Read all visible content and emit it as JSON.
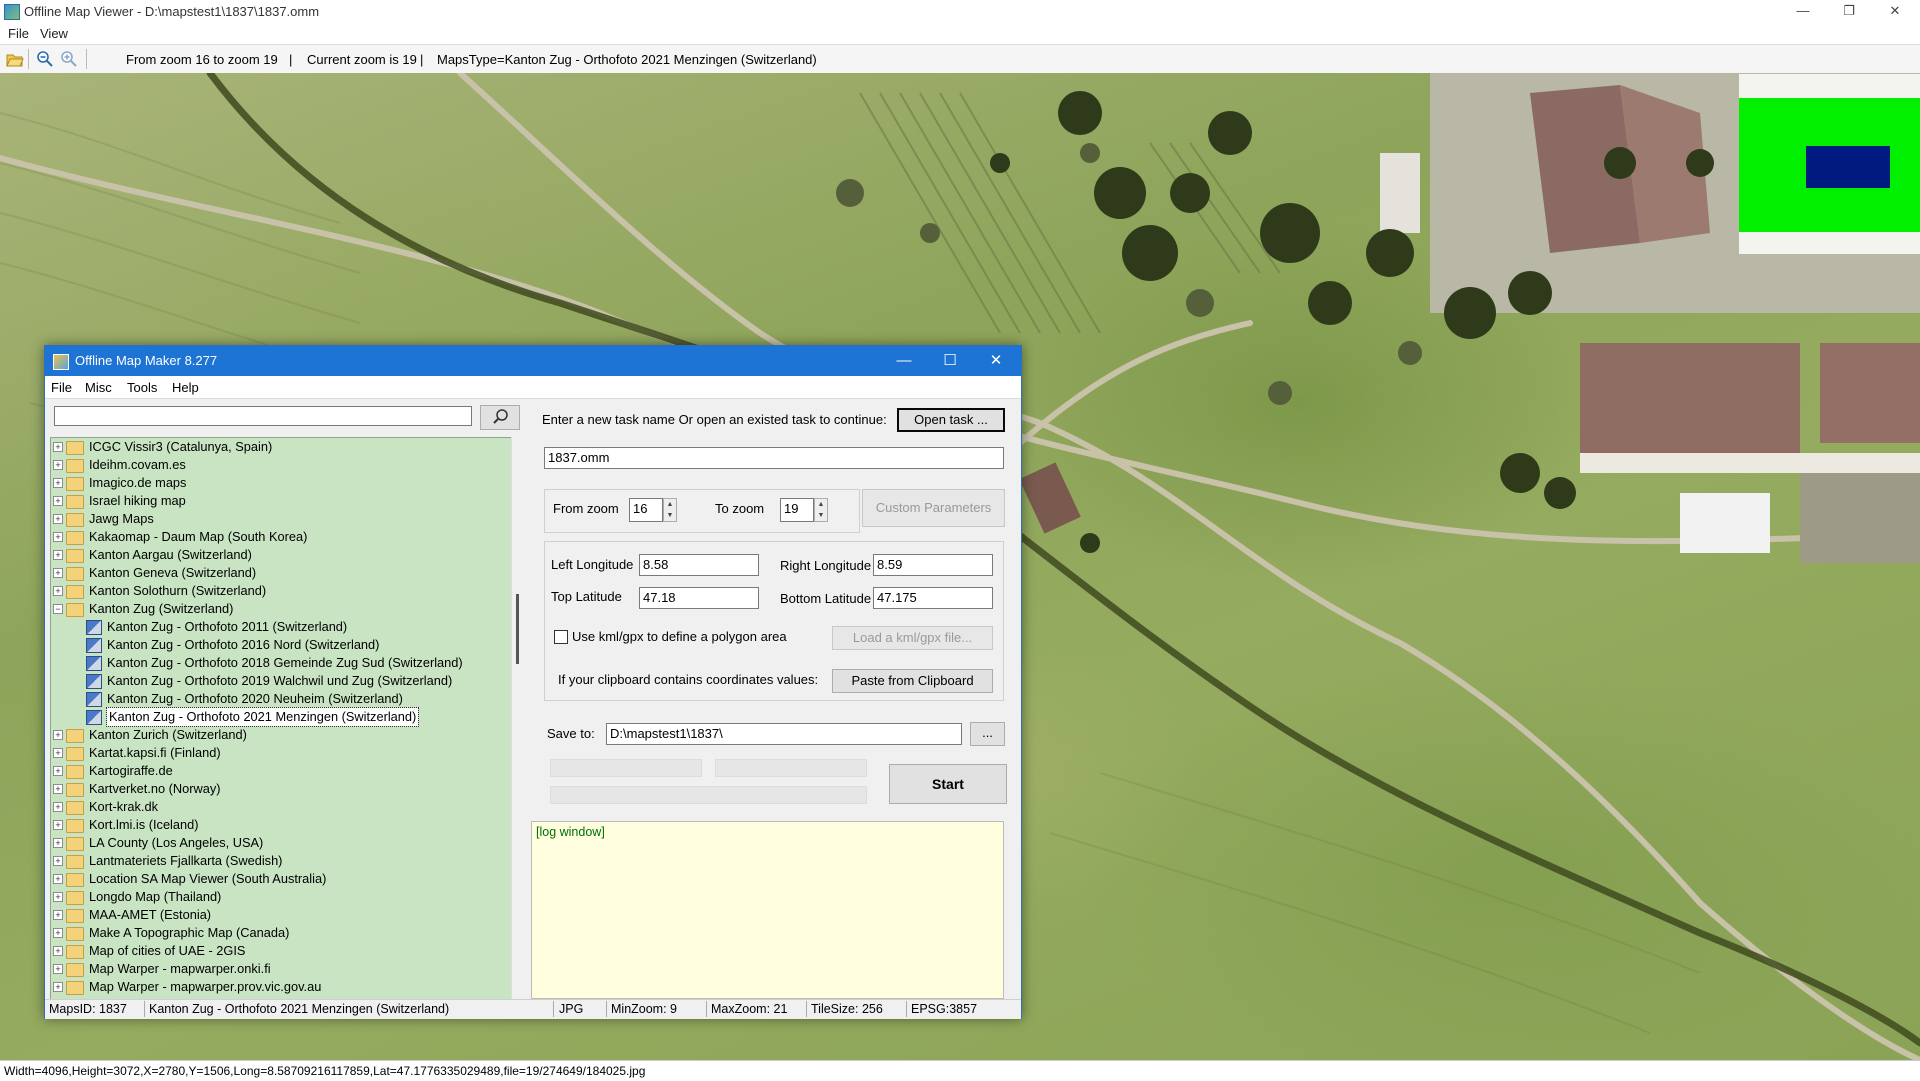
{
  "viewer": {
    "title": "Offline Map Viewer - D:\\mapstest1\\1837\\1837.omm",
    "menu": [
      "File",
      "View"
    ],
    "toolbar": {
      "zoom_range": "From zoom 16 to zoom 19",
      "current_zoom": "Current zoom is 19",
      "maps_type": "MapsType=Kanton Zug - Orthofoto 2021 Menzingen (Switzerland)",
      "sep": "|"
    },
    "window_controls": {
      "minimize": "—",
      "maximize": "❐",
      "close": "✕"
    },
    "status_bar": "Width=4096,Height=3072,X=2780,Y=1506,Long=8.58709216117859,Lat=47.1776335029489,file=19/274649/184025.jpg"
  },
  "dialog": {
    "title": "Offline Map Maker 8.277",
    "menu": [
      "File",
      "Misc",
      "Tools",
      "Help"
    ],
    "search": {
      "value": "",
      "placeholder": ""
    },
    "tree": [
      {
        "label": "ICGC Vissir3 (Catalunya, Spain)",
        "level": 0,
        "expander": "+"
      },
      {
        "label": "Ideihm.covam.es",
        "level": 0,
        "expander": "+"
      },
      {
        "label": "Imagico.de maps",
        "level": 0,
        "expander": "+"
      },
      {
        "label": "Israel hiking map",
        "level": 0,
        "expander": "+"
      },
      {
        "label": "Jawg Maps",
        "level": 0,
        "expander": "+"
      },
      {
        "label": "Kakaomap - Daum Map (South Korea)",
        "level": 0,
        "expander": "+"
      },
      {
        "label": "Kanton Aargau (Switzerland)",
        "level": 0,
        "expander": "+"
      },
      {
        "label": "Kanton Geneva (Switzerland)",
        "level": 0,
        "expander": "+"
      },
      {
        "label": "Kanton Solothurn (Switzerland)",
        "level": 0,
        "expander": "+"
      },
      {
        "label": "Kanton Zug (Switzerland)",
        "level": 0,
        "expander": "−"
      },
      {
        "label": "Kanton Zug - Orthofoto 2011 (Switzerland)",
        "level": 1
      },
      {
        "label": "Kanton Zug - Orthofoto 2016 Nord (Switzerland)",
        "level": 1
      },
      {
        "label": "Kanton Zug - Orthofoto 2018 Gemeinde Zug Sud (Switzerland)",
        "level": 1
      },
      {
        "label": "Kanton Zug - Orthofoto 2019 Walchwil und Zug (Switzerland)",
        "level": 1
      },
      {
        "label": "Kanton Zug - Orthofoto 2020 Neuheim (Switzerland)",
        "level": 1
      },
      {
        "label": "Kanton Zug - Orthofoto 2021 Menzingen (Switzerland)",
        "level": 1,
        "selected": true
      },
      {
        "label": "Kanton Zurich (Switzerland)",
        "level": 0,
        "expander": "+"
      },
      {
        "label": "Kartat.kapsi.fi (Finland)",
        "level": 0,
        "expander": "+"
      },
      {
        "label": "Kartogiraffe.de",
        "level": 0,
        "expander": "+"
      },
      {
        "label": "Kartverket.no (Norway)",
        "level": 0,
        "expander": "+"
      },
      {
        "label": "Kort-krak.dk",
        "level": 0,
        "expander": "+"
      },
      {
        "label": "Kort.lmi.is (Iceland)",
        "level": 0,
        "expander": "+"
      },
      {
        "label": "LA County (Los Angeles, USA)",
        "level": 0,
        "expander": "+"
      },
      {
        "label": "Lantmateriets Fjallkarta (Swedish)",
        "level": 0,
        "expander": "+"
      },
      {
        "label": "Location SA Map Viewer (South Australia)",
        "level": 0,
        "expander": "+"
      },
      {
        "label": "Longdo Map (Thailand)",
        "level": 0,
        "expander": "+"
      },
      {
        "label": "MAA-AMET (Estonia)",
        "level": 0,
        "expander": "+"
      },
      {
        "label": "Make A Topographic Map (Canada)",
        "level": 0,
        "expander": "+"
      },
      {
        "label": "Map of cities of UAE - 2GIS",
        "level": 0,
        "expander": "+"
      },
      {
        "label": "Map Warper - mapwarper.onki.fi",
        "level": 0,
        "expander": "+"
      },
      {
        "label": "Map Warper - mapwarper.prov.vic.gov.au",
        "level": 0,
        "expander": "+"
      }
    ],
    "task": {
      "prompt": "Enter a new task name Or open an existed task to continue:",
      "open_button": "Open task ...",
      "name_value": "1837.omm"
    },
    "zoom": {
      "from_label": "From zoom",
      "from_value": "16",
      "to_label": "To zoom",
      "to_value": "19",
      "custom_button": "Custom Parameters",
      "spin_up": "▲",
      "spin_down": "▼"
    },
    "coords": {
      "left_lon_label": "Left Longitude",
      "left_lon": "8.58",
      "right_lon_label": "Right Longitude",
      "right_lon": "8.59",
      "top_lat_label": "Top Latitude",
      "top_lat": "47.18",
      "bottom_lat_label": "Bottom Latitude",
      "bottom_lat": "47.175",
      "kml_checkbox_label": "Use kml/gpx to define a polygon area",
      "kml_checked": false,
      "load_kml_button": "Load a kml/gpx file...",
      "clipboard_label": "If your clipboard contains coordinates values:",
      "paste_button": "Paste from Clipboard"
    },
    "save": {
      "label": "Save to:",
      "path": "D:\\mapstest1\\1837\\",
      "browse_button": "..."
    },
    "start_button": "Start",
    "log_text": "[log window]",
    "status": {
      "maps_id": "MapsID: 1837",
      "map_name": "Kanton Zug - Orthofoto 2021 Menzingen (Switzerland)",
      "format": "JPG",
      "min_zoom": "MinZoom: 9",
      "max_zoom": "MaxZoom: 21",
      "tile_size": "TileSize: 256",
      "epsg": "EPSG:3857"
    },
    "window_controls": {
      "minimize": "—",
      "maximize": "☐",
      "close": "✕"
    }
  },
  "icons": {
    "open": "open-folder-icon",
    "zoom_out": "zoom-out-icon",
    "zoom_in": "zoom-in-icon",
    "search": "search-icon",
    "folder": "folder-icon",
    "map": "map-layer-icon"
  },
  "colors": {
    "dialog_titlebar": "#1e74d4",
    "tree_background": "#c8e4c3",
    "log_background": "#ffffe0",
    "log_text": "#007000",
    "minimap_area": "#00f000",
    "minimap_viewport": "#001a80"
  }
}
